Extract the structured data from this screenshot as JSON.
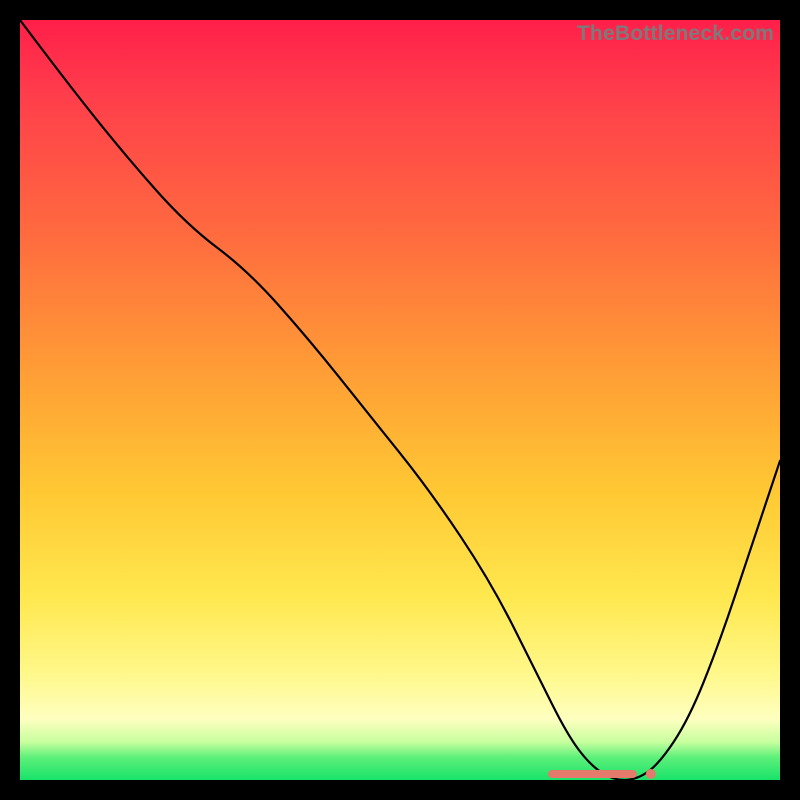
{
  "watermark": "TheBottleneck.com",
  "colors": {
    "gradient_top": "#ff1f4a",
    "gradient_mid1": "#ff9a36",
    "gradient_mid2": "#ffe84f",
    "gradient_bottom": "#18e36a",
    "curve": "#000000",
    "marker": "#e47a6b",
    "frame": "#000000"
  },
  "chart_data": {
    "type": "line",
    "title": "",
    "xlabel": "",
    "ylabel": "",
    "xlim": [
      0,
      100
    ],
    "ylim": [
      0,
      100
    ],
    "grid": false,
    "legend": false,
    "series": [
      {
        "name": "bottleneck-curve",
        "x": [
          0,
          6,
          14,
          22,
          30,
          38,
          46,
          54,
          62,
          68,
          72,
          75,
          78,
          81,
          84,
          88,
          92,
          96,
          100
        ],
        "y": [
          100,
          92,
          82,
          73,
          67,
          58,
          48,
          38,
          26,
          14,
          6,
          2,
          0,
          0,
          2,
          8,
          18,
          30,
          42
        ]
      }
    ],
    "markers": {
      "name": "optimal-range",
      "x": [
        70,
        72,
        74,
        76,
        78,
        80,
        83
      ],
      "y": [
        0,
        0,
        0,
        0,
        0,
        0,
        0
      ]
    }
  }
}
